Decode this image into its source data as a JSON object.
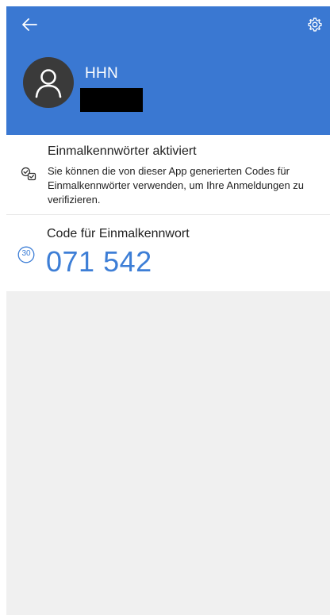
{
  "header": {
    "back_icon": "arrow-left-icon",
    "settings_icon": "gear-icon",
    "account_name": "HHN",
    "account_detail_redacted": true,
    "color": "#3a78d2"
  },
  "otp_status": {
    "title": "Einmalkennwörter aktiviert",
    "description": "Sie können die von dieser App generierten Codes für Einmalkennwörter verwenden, um Ihre Anmeldungen zu verifizieren.",
    "icon": "verified-codes-icon"
  },
  "otp_code": {
    "label": "Code für Einmalkennwort",
    "code": "071 542",
    "timer_seconds": "30",
    "color": "#3d7ed6"
  }
}
